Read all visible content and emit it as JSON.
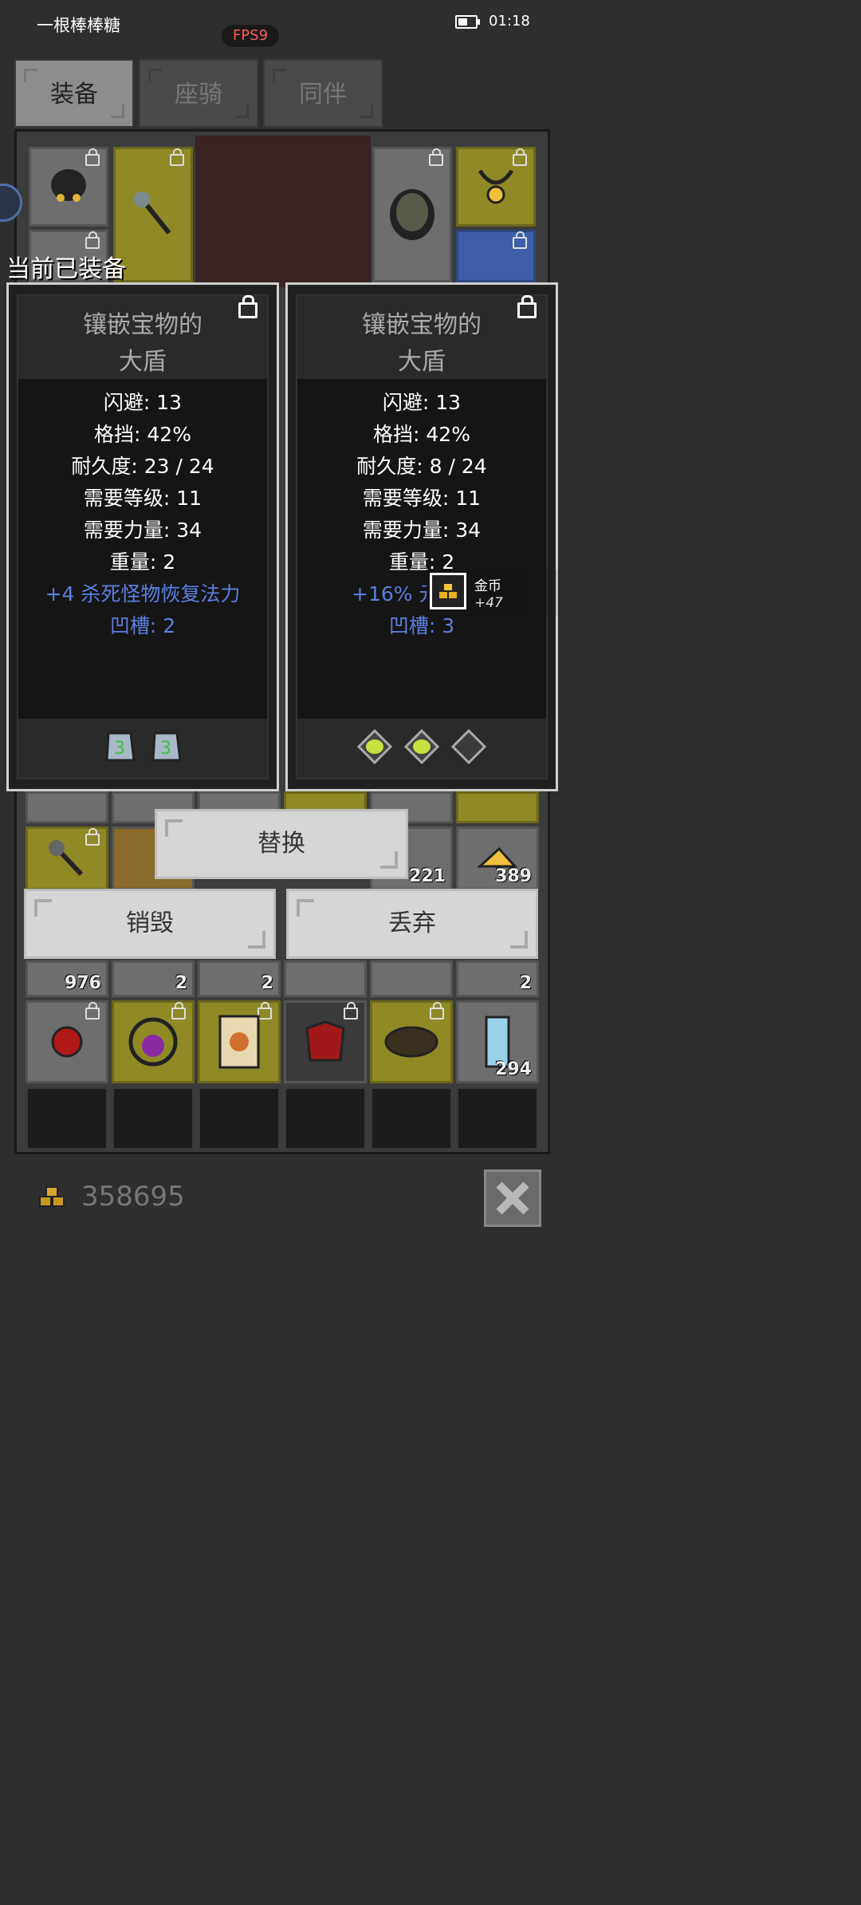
{
  "status_bar": {
    "app_name": "一根棒棒糖",
    "fps": "FPS9",
    "time": "01:18"
  },
  "tabs": [
    {
      "label": "装备",
      "active": true
    },
    {
      "label": "座骑",
      "active": false
    },
    {
      "label": "同伴",
      "active": false
    }
  ],
  "equipped_label": "当前已装备",
  "cards": [
    {
      "title_line1": "镶嵌宝物的",
      "title_line2": "大盾",
      "stats": [
        "闪避: 13",
        "格挡: 42%",
        "耐久度: 23 / 24",
        "需要等级: 11",
        "需要力量: 34",
        "重量: 2"
      ],
      "bonus": "+4 杀死怪物恢复法力",
      "sockets": "凹槽: 2"
    },
    {
      "title_line1": "镶嵌宝物的",
      "title_line2": "大盾",
      "stats": [
        "闪避: 13",
        "格挡: 42%",
        "耐久度: 8 / 24",
        "需要等级: 11",
        "需要力量: 34",
        "重量: 2"
      ],
      "bonus": "+16% 元",
      "sockets": "凹槽: 3"
    }
  ],
  "toast": {
    "name": "金币",
    "amount": "+47"
  },
  "buttons": {
    "replace": "替换",
    "destroy": "销毁",
    "discard": "丢弃"
  },
  "inventory_counts": {
    "c976": "976",
    "c2a": "2",
    "c2b": "2",
    "c2c": "2",
    "c221": "221",
    "c389": "389",
    "c294": "294"
  },
  "gold_total": "358695",
  "icons": [
    "lock-icon",
    "shield-icon",
    "mace-icon",
    "amulet-icon",
    "ring-icon",
    "gem-icon",
    "coin-icon",
    "scroll-icon",
    "close-icon"
  ],
  "colors": {
    "bonus_blue": "#5b7fe0",
    "fps_red": "#ff5a5a",
    "gold_slot": "#8f8a26"
  }
}
